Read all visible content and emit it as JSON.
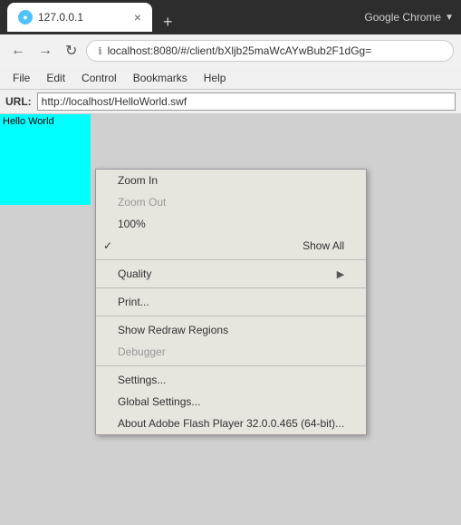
{
  "browser": {
    "chrome_label": "Google Chrome",
    "tab": {
      "title": "127.0.0.1",
      "favicon": "●",
      "close": "×"
    },
    "tab_new": "+",
    "nav": {
      "back": "←",
      "forward": "→",
      "reload": "↻",
      "address_icon": "ℹ",
      "address_url": "localhost:8080/#/client/bXljb25maWcAYwBub2F1dGg="
    }
  },
  "flash": {
    "menubar": {
      "items": [
        "File",
        "Edit",
        "Control",
        "Bookmarks",
        "Help"
      ]
    },
    "url_label": "URL:",
    "url_value": "http://localhost/HelloWorld.swf",
    "canvas": {
      "hello_world": "Hello World"
    },
    "context_menu": {
      "items": [
        {
          "label": "Zoom In",
          "disabled": false,
          "checked": false,
          "has_submenu": false
        },
        {
          "label": "Zoom Out",
          "disabled": true,
          "checked": false,
          "has_submenu": false
        },
        {
          "label": "100%",
          "disabled": false,
          "checked": false,
          "has_submenu": false
        },
        {
          "label": "Show All",
          "disabled": false,
          "checked": true,
          "has_submenu": false
        },
        {
          "separator": true
        },
        {
          "label": "Quality",
          "disabled": false,
          "checked": false,
          "has_submenu": true
        },
        {
          "separator": true
        },
        {
          "label": "Print...",
          "disabled": false,
          "checked": false,
          "has_submenu": false
        },
        {
          "separator": true
        },
        {
          "label": "Show Redraw Regions",
          "disabled": false,
          "checked": false,
          "has_submenu": false
        },
        {
          "label": "Debugger",
          "disabled": true,
          "checked": false,
          "has_submenu": false
        },
        {
          "separator": true
        },
        {
          "label": "Settings...",
          "disabled": false,
          "checked": false,
          "has_submenu": false
        },
        {
          "label": "Global Settings...",
          "disabled": false,
          "checked": false,
          "has_submenu": false
        },
        {
          "label": "About Adobe Flash Player 32.0.0.465 (64-bit)...",
          "disabled": false,
          "checked": false,
          "has_submenu": false
        }
      ]
    }
  }
}
